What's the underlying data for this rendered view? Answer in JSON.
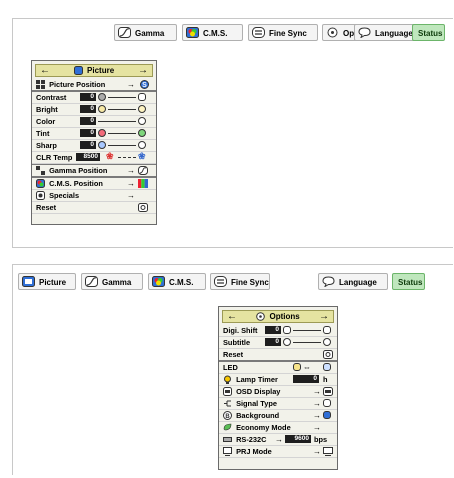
{
  "top": {
    "tabs": [
      {
        "label": "Gamma",
        "icon": "gamma-icon"
      },
      {
        "label": "C.M.S.",
        "icon": "cms-icon"
      },
      {
        "label": "Fine Sync",
        "icon": "fine-sync-icon"
      },
      {
        "label": "Options",
        "icon": "options-icon"
      },
      {
        "label": "Language",
        "icon": "language-icon"
      },
      {
        "label": "Status"
      }
    ],
    "menu": {
      "title": "Picture",
      "items": [
        {
          "label": "Picture Position"
        },
        {
          "label": "Contrast",
          "value": "0"
        },
        {
          "label": "Bright",
          "value": "0"
        },
        {
          "label": "Color",
          "value": "0"
        },
        {
          "label": "Tint",
          "value": "0"
        },
        {
          "label": "Sharp",
          "value": "0"
        },
        {
          "label": "CLR Temp",
          "value": "8500"
        },
        {
          "label": "Gamma Position"
        },
        {
          "label": "C.M.S. Position"
        },
        {
          "label": "Specials"
        },
        {
          "label": "Reset"
        }
      ]
    }
  },
  "bottom": {
    "tabs": [
      {
        "label": "Picture",
        "icon": "picture-icon"
      },
      {
        "label": "Gamma",
        "icon": "gamma-icon"
      },
      {
        "label": "C.M.S.",
        "icon": "cms-icon"
      },
      {
        "label": "Fine Sync",
        "icon": "fine-sync-icon"
      },
      {
        "label": "Language",
        "icon": "language-icon"
      },
      {
        "label": "Status"
      }
    ],
    "menu": {
      "title": "Options",
      "items": [
        {
          "label": "Digi. Shift",
          "value": "0"
        },
        {
          "label": "Subtitle",
          "value": "0"
        },
        {
          "label": "Reset"
        },
        {
          "label": "LED"
        },
        {
          "label": "Lamp Timer",
          "value": "0",
          "unit": "h"
        },
        {
          "label": "OSD Display"
        },
        {
          "label": "Signal Type"
        },
        {
          "label": "Background"
        },
        {
          "label": "Economy Mode"
        },
        {
          "label": "RS-232C",
          "value": "9600",
          "unit": "bps"
        },
        {
          "label": "PRJ Mode"
        }
      ]
    }
  }
}
